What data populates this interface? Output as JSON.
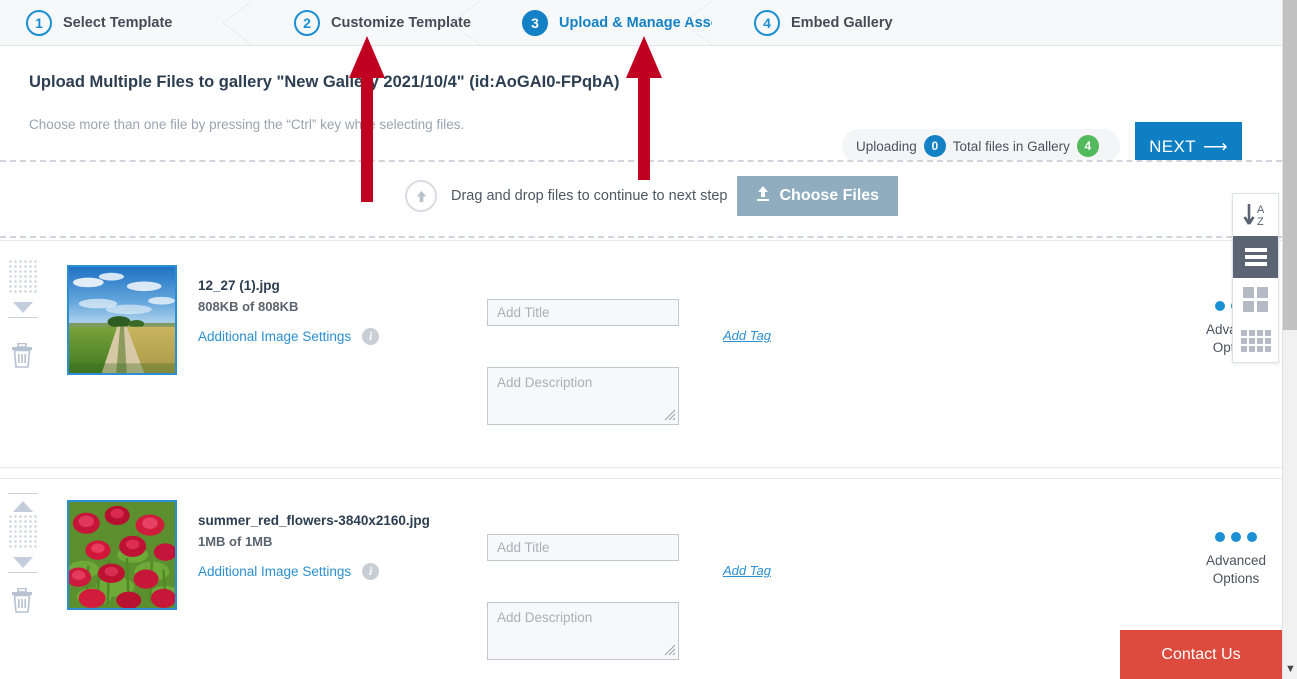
{
  "steps": [
    {
      "num": "1",
      "label": "Select Template",
      "active": false
    },
    {
      "num": "2",
      "label": "Customize Template",
      "active": false
    },
    {
      "num": "3",
      "label": "Upload & Manage Assets",
      "active": true
    },
    {
      "num": "4",
      "label": "Embed Gallery",
      "active": false
    }
  ],
  "header": {
    "title": "Upload Multiple Files to gallery \"New Gallery 2021/10/4\" (id:AoGAI0-FPqbA)",
    "subtitle": "Choose more than one file by pressing the “Ctrl” key while selecting files.",
    "status": {
      "uploading_label": "Uploading",
      "uploading_count": "0",
      "total_label": "Total files in Gallery",
      "total_count": "4"
    },
    "next_button": "NEXT"
  },
  "dropzone": {
    "icon": "upload-circle-icon",
    "text": "Drag and drop files to continue to next step",
    "choose_button": "Choose Files"
  },
  "files": [
    {
      "name": "12_27 (1).jpg",
      "size": "808KB of 808KB",
      "settings_link": "Additional Image Settings",
      "title_placeholder": "Add Title",
      "title_value": "",
      "description_placeholder": "Add Description",
      "description_value": "",
      "add_tag": "Add Tag",
      "advanced_options": "Advanced Options",
      "thumb": "landscape-field-path"
    },
    {
      "name": "summer_red_flowers-3840x2160.jpg",
      "size": "1MB of 1MB",
      "settings_link": "Additional Image Settings",
      "title_placeholder": "Add Title",
      "title_value": "",
      "description_placeholder": "Add Description",
      "description_value": "",
      "add_tag": "Add Tag",
      "advanced_options": "Advanced Options",
      "thumb": "red-daisy-flowers"
    }
  ],
  "view_panel": {
    "items": [
      {
        "icon": "sort-az-icon",
        "active": false
      },
      {
        "icon": "list-view-icon",
        "active": true
      },
      {
        "icon": "grid-view-icon",
        "active": false
      },
      {
        "icon": "small-grid-view-icon",
        "active": false
      }
    ]
  },
  "contact_us": "Contact Us",
  "colors": {
    "accent_blue": "#1481c6",
    "link_blue": "#2b8fd1",
    "green_badge": "#52b95c",
    "contact_red": "#dd4b3e",
    "annotation_red": "#c00020",
    "choose_button": "#8fadbf"
  }
}
